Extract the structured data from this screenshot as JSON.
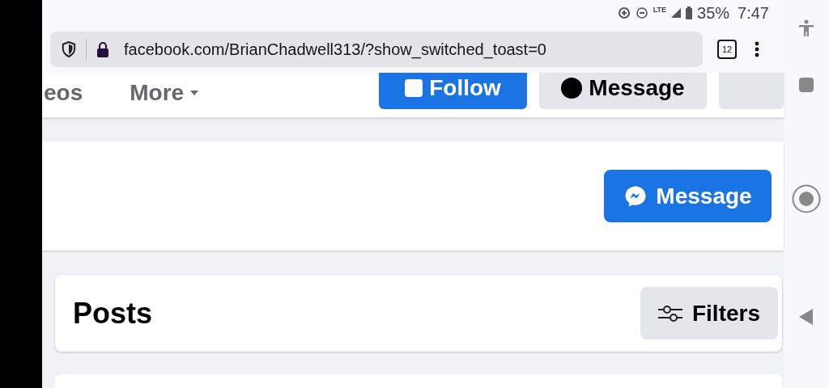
{
  "status_bar": {
    "network": "LTE",
    "battery": "35%",
    "time": "7:47"
  },
  "browser": {
    "url": "facebook.com/BrianChadwell313/?show_switched_toast=0",
    "tab_count": "12"
  },
  "profile_nav": {
    "tabs": [
      {
        "label": "eos"
      },
      {
        "label": "More"
      }
    ],
    "buttons": [
      {
        "kind": "primary",
        "label": "Follow"
      },
      {
        "kind": "secondary",
        "label": "Message"
      },
      {
        "kind": "overflow"
      }
    ]
  },
  "message_button": {
    "label": "Message"
  },
  "posts": {
    "title": "Posts",
    "filters_button": "Filters"
  }
}
